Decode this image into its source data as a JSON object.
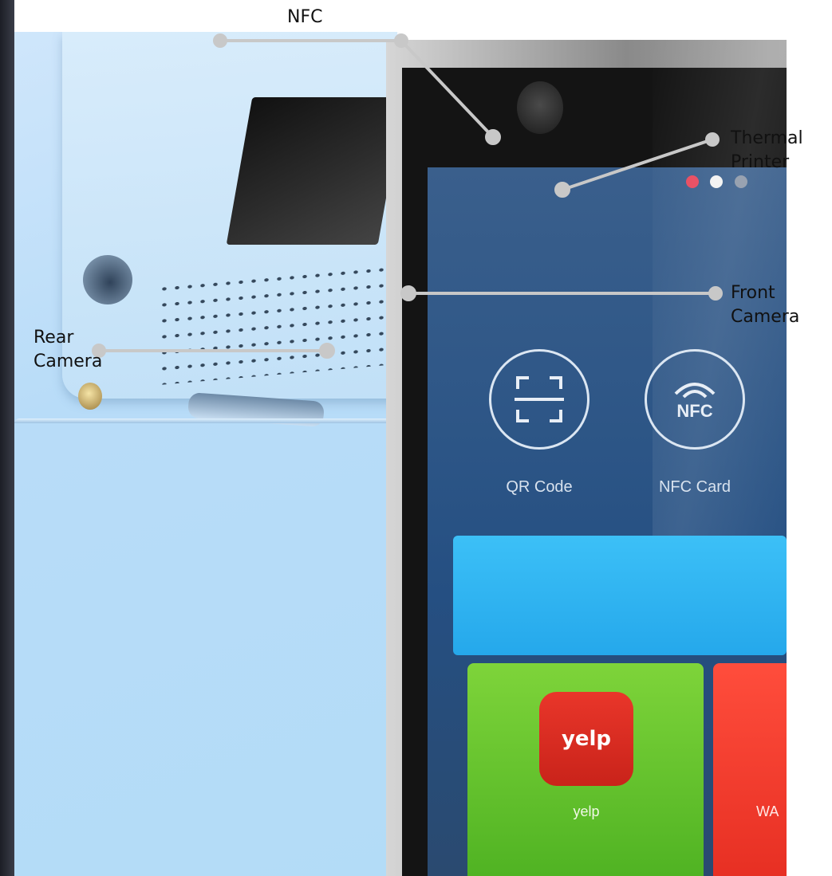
{
  "labels": {
    "nfc": "NFC",
    "thermal_printer_line1": "Thermal",
    "thermal_printer_line2": "Printer",
    "front_camera_line1": "Front",
    "front_camera_line2": "Camera",
    "rear_camera_line1": "Rear",
    "rear_camera_line2": "Camera"
  },
  "screen": {
    "qr_button_label": "QR Code",
    "nfc_button_label": "NFC Card",
    "nfc_icon_text": "NFC",
    "app_tile_label": "yelp",
    "app_tile_icon_text": "yelp",
    "red_tile_label": "WA"
  },
  "colors": {
    "housing": "#b8dcf8",
    "annotation_line": "#c8c8c8",
    "banner": "#3cc0f7",
    "tile_green": "#7ed43a",
    "tile_red": "#ff4d3c"
  }
}
